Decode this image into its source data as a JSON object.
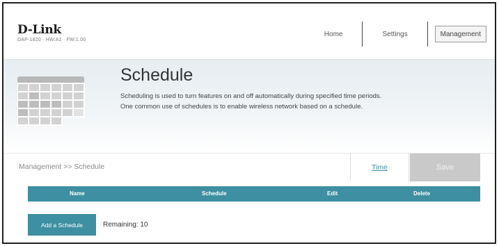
{
  "brand": {
    "logo_text": "D-Link",
    "device_info": "DAP-1820 · HW:A1 · FW:1.00"
  },
  "nav": {
    "items": [
      {
        "label": "Home"
      },
      {
        "label": "Settings"
      },
      {
        "label": "Management"
      }
    ],
    "active": "Management"
  },
  "hero": {
    "title": "Schedule",
    "description_line1": "Scheduling is used to turn features on and off automatically during specified time periods.",
    "description_line2": "One common use of schedules is to enable wireless network based on a schedule."
  },
  "breadcrumb": "Management >> Schedule",
  "actions": {
    "time_label": "Time",
    "save_label": "Save"
  },
  "table": {
    "columns": [
      "Name",
      "Schedule",
      "Edit",
      "Delete"
    ]
  },
  "footer": {
    "add_label": "Add a Schedule",
    "remaining_text": "Remaining: 10"
  },
  "colors": {
    "accent": "#3d8fa1",
    "save_disabled": "#c9c9c9",
    "link": "#3a8ba5"
  }
}
